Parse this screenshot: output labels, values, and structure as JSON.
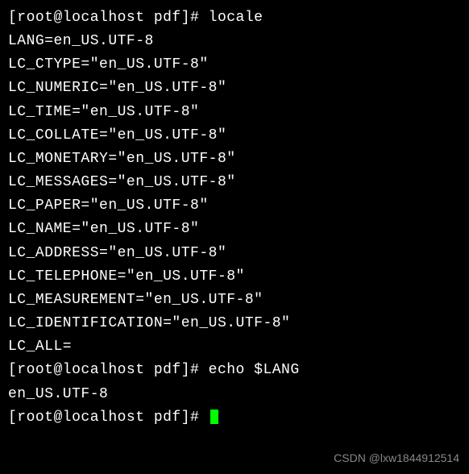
{
  "terminal": {
    "lines": [
      "[root@localhost pdf]# locale",
      "LANG=en_US.UTF-8",
      "LC_CTYPE=\"en_US.UTF-8\"",
      "LC_NUMERIC=\"en_US.UTF-8\"",
      "LC_TIME=\"en_US.UTF-8\"",
      "LC_COLLATE=\"en_US.UTF-8\"",
      "LC_MONETARY=\"en_US.UTF-8\"",
      "LC_MESSAGES=\"en_US.UTF-8\"",
      "LC_PAPER=\"en_US.UTF-8\"",
      "LC_NAME=\"en_US.UTF-8\"",
      "LC_ADDRESS=\"en_US.UTF-8\"",
      "LC_TELEPHONE=\"en_US.UTF-8\"",
      "LC_MEASUREMENT=\"en_US.UTF-8\"",
      "LC_IDENTIFICATION=\"en_US.UTF-8\"",
      "LC_ALL=",
      "[root@localhost pdf]# echo $LANG",
      "en_US.UTF-8"
    ],
    "prompt_final": "[root@localhost pdf]# "
  },
  "watermark": "CSDN @lxw1844912514"
}
